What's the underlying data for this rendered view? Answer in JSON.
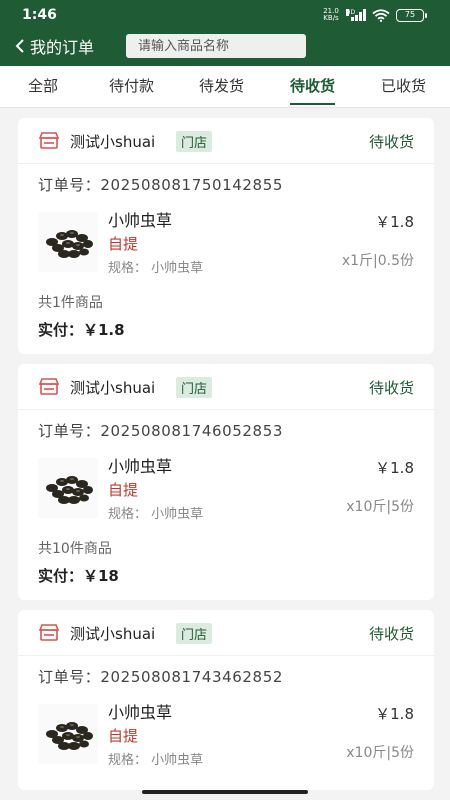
{
  "status_bar": {
    "time": "1:46",
    "net_speed_top": "21.0",
    "net_speed_unit": "KB/s",
    "network": "HD",
    "battery": "75"
  },
  "nav": {
    "back_label": "我的订单",
    "search_placeholder": "请输入商品名称"
  },
  "tabs": [
    {
      "label": "全部",
      "active": false
    },
    {
      "label": "待付款",
      "active": false
    },
    {
      "label": "待发货",
      "active": false
    },
    {
      "label": "待收货",
      "active": true
    },
    {
      "label": "已收货",
      "active": false
    }
  ],
  "orders": [
    {
      "shop_name": "测试小shuai",
      "badge": "门店",
      "status": "待收货",
      "order_no": "订单号：2025080817501428​55",
      "product_name": "小帅虫草",
      "pickup": "自提",
      "spec": "规格：  小帅虫草",
      "price": "￥1.8",
      "qty": "x1斤|0.5份",
      "item_count": "共1件商品",
      "paid": "实付：￥1.8"
    },
    {
      "shop_name": "测试小shuai",
      "badge": "门店",
      "status": "待收货",
      "order_no": "订单号：202508081746052853",
      "product_name": "小帅虫草",
      "pickup": "自提",
      "spec": "规格：  小帅虫草",
      "price": "￥1.8",
      "qty": "x10斤|5份",
      "item_count": "共10件商品",
      "paid": "实付：￥18"
    },
    {
      "shop_name": "测试小shuai",
      "badge": "门店",
      "status": "待收货",
      "order_no": "订单号：202508081743462852",
      "product_name": "小帅虫草",
      "pickup": "自提",
      "spec": "规格：  小帅虫草",
      "price": "￥1.8",
      "qty": "x10斤|5份",
      "item_count": "",
      "paid": ""
    }
  ],
  "colors": {
    "brand": "#1f5b34",
    "pickup": "#c0392b",
    "badge_bg": "#dcebe0"
  }
}
